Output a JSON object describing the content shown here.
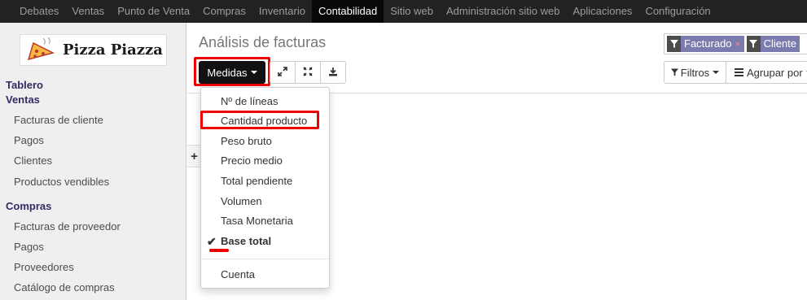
{
  "topnav": {
    "items": [
      {
        "label": "Debates"
      },
      {
        "label": "Ventas"
      },
      {
        "label": "Punto de Venta"
      },
      {
        "label": "Compras"
      },
      {
        "label": "Inventario"
      },
      {
        "label": "Contabilidad",
        "active": true
      },
      {
        "label": "Sitio web"
      },
      {
        "label": "Administración sitio web"
      },
      {
        "label": "Aplicaciones"
      },
      {
        "label": "Configuración"
      }
    ]
  },
  "sidebar": {
    "logo_text": "Pizza Piazza",
    "sections": [
      {
        "label": "Tablero"
      },
      {
        "label": "Ventas"
      },
      {
        "label": "Compras"
      }
    ],
    "ventas_links": [
      {
        "label": "Facturas de cliente"
      },
      {
        "label": "Pagos"
      },
      {
        "label": "Clientes"
      },
      {
        "label": "Productos vendibles"
      }
    ],
    "compras_links": [
      {
        "label": "Facturas de proveedor"
      },
      {
        "label": "Pagos"
      },
      {
        "label": "Proveedores"
      },
      {
        "label": "Catálogo de compras"
      }
    ]
  },
  "main": {
    "title": "Análisis de facturas",
    "measures_button": "Medidas",
    "pivot_add": "+",
    "search": {
      "facets": [
        {
          "label": "Facturado",
          "remove": "×"
        },
        {
          "label": "Cliente"
        }
      ]
    },
    "filters_button": "Filtros",
    "groupby_button": "Agrupar por"
  },
  "measures_dropdown": {
    "items": [
      {
        "label": "Nº de líneas"
      },
      {
        "label": "Cantidad producto",
        "highlighted": true
      },
      {
        "label": "Peso bruto"
      },
      {
        "label": "Precio medio"
      },
      {
        "label": "Total pendiente"
      },
      {
        "label": "Volumen"
      },
      {
        "label": "Tasa Monetaria"
      },
      {
        "label": "Base total",
        "checked": true
      }
    ],
    "count_item": {
      "label": "Cuenta"
    },
    "check_glyph": "✔"
  },
  "colors": {
    "navbar_bg": "#222222",
    "active_menu_bg": "#080808",
    "sidebar_bg": "#f0eeee",
    "section_color": "#2f2d63",
    "facet_bg": "#7c7bad",
    "annotation_red": "#ee0000"
  },
  "icons": {
    "expand": "expand-icon",
    "flip_axis": "flip-axis-icon",
    "download": "download-icon",
    "filter": "filter-icon",
    "groupby": "list-icon"
  }
}
